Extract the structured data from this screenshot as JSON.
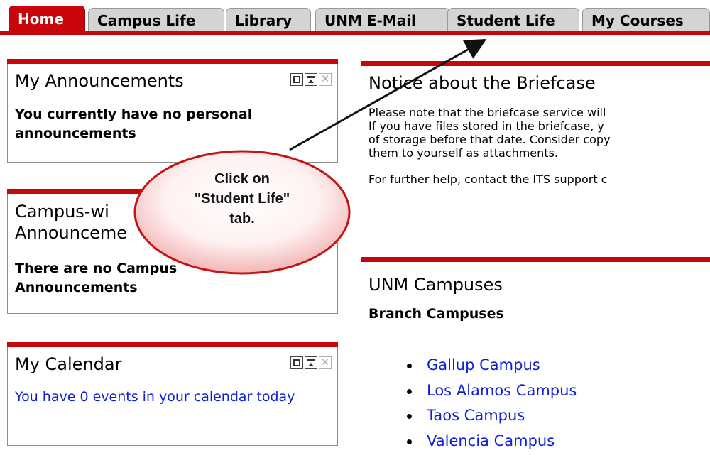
{
  "tabs": [
    {
      "label": "Home",
      "active": true
    },
    {
      "label": "Campus Life"
    },
    {
      "label": "Library"
    },
    {
      "label": "UNM E-Mail"
    },
    {
      "label": "Student Life"
    },
    {
      "label": "My Courses"
    }
  ],
  "announcements": {
    "title": "My Announcements",
    "body": "You currently have no personal announcements"
  },
  "campus_wide": {
    "title_line1": "Campus-wi",
    "title_line2": "Announceme",
    "body": "There are no Campus Announcements"
  },
  "calendar": {
    "title": "My Calendar",
    "body": "You have 0 events in your calendar today"
  },
  "briefcase": {
    "title": "Notice about the Briefcase",
    "lines": [
      "Please note that the briefcase service will",
      "If you have files stored in the briefcase, y",
      "of storage before that date. Consider copy",
      "them to yourself as attachments."
    ],
    "help": "For further help, contact the ITS support c"
  },
  "campuses": {
    "title": "UNM Campuses",
    "subtitle": "Branch Campuses",
    "items": [
      "Gallup Campus",
      "Los Alamos Campus",
      "Taos Campus",
      "Valencia Campus"
    ]
  },
  "callout": {
    "line1": "Click on",
    "line2": "\"Student Life\"",
    "line3": "tab."
  },
  "colors": {
    "accent": "#c8050b",
    "link": "#0e1fd6",
    "tab_inactive": "#d4d4d4"
  },
  "icons": [
    "maximize-icon",
    "minimize-icon",
    "close-icon"
  ]
}
